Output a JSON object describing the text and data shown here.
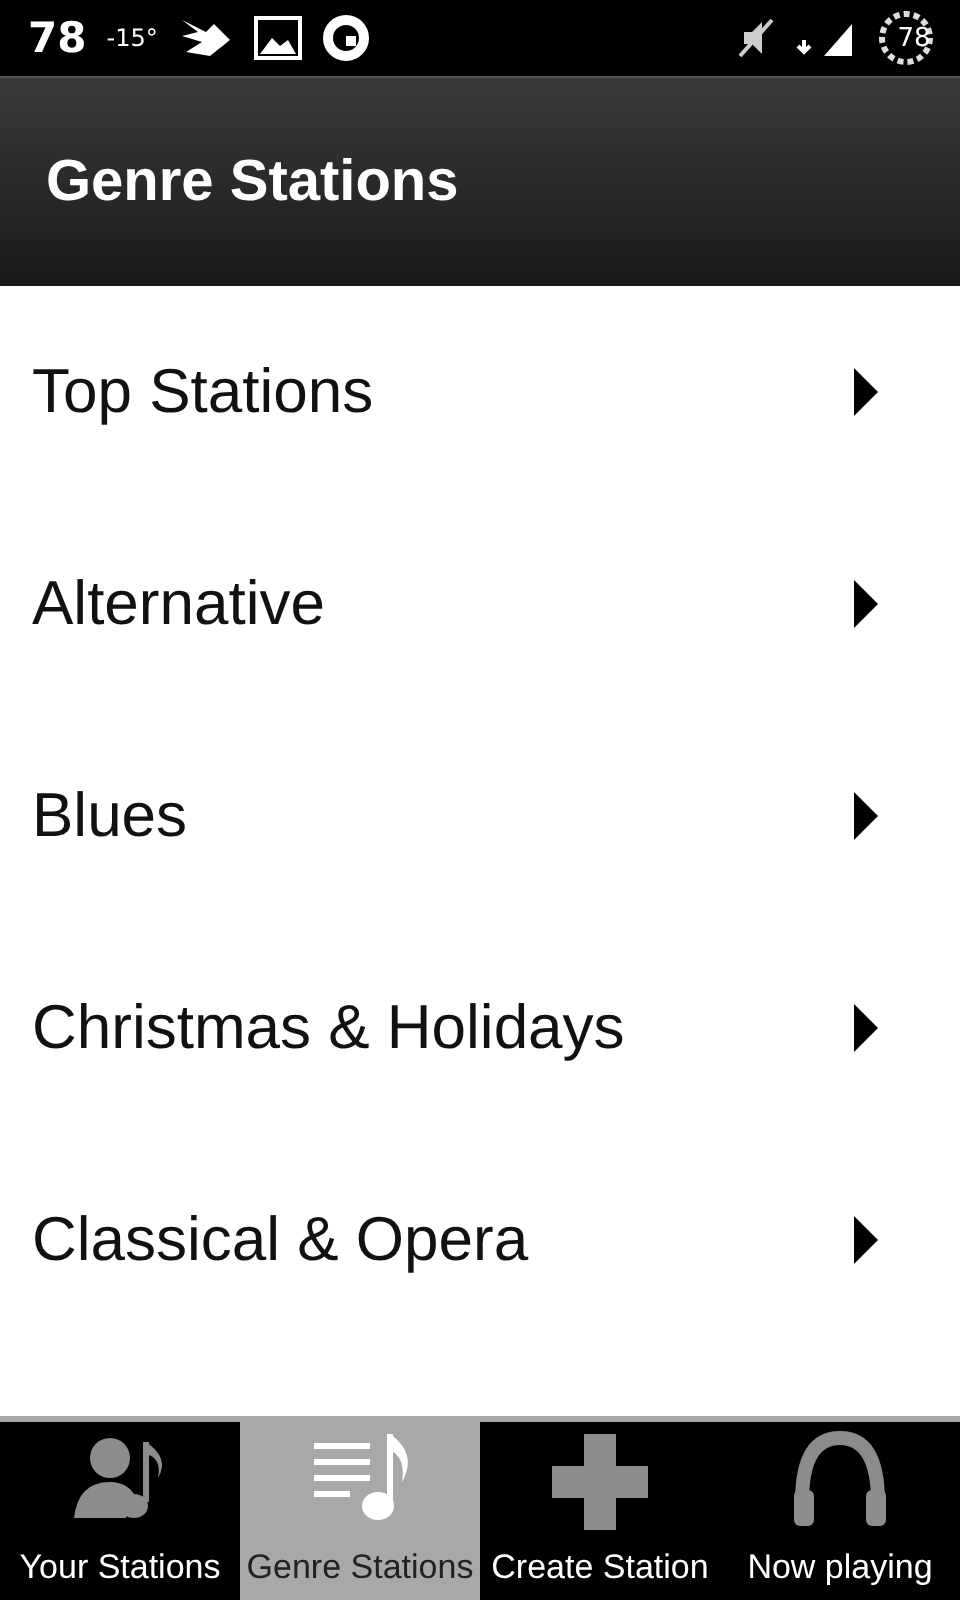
{
  "status_bar": {
    "temperature_big": "78",
    "temperature": "-15°",
    "battery": "78"
  },
  "header": {
    "title": "Genre Stations"
  },
  "genres": [
    {
      "label": "Top Stations"
    },
    {
      "label": "Alternative"
    },
    {
      "label": "Blues"
    },
    {
      "label": "Christmas & Holidays"
    },
    {
      "label": "Classical & Opera"
    }
  ],
  "tabs": [
    {
      "label": "Your Stations",
      "kind": "person-note",
      "selected": false
    },
    {
      "label": "Genre Stations",
      "kind": "list-note",
      "selected": true
    },
    {
      "label": "Create Station",
      "kind": "plus",
      "selected": false
    },
    {
      "label": "Now playing",
      "kind": "headphones",
      "selected": false
    }
  ]
}
